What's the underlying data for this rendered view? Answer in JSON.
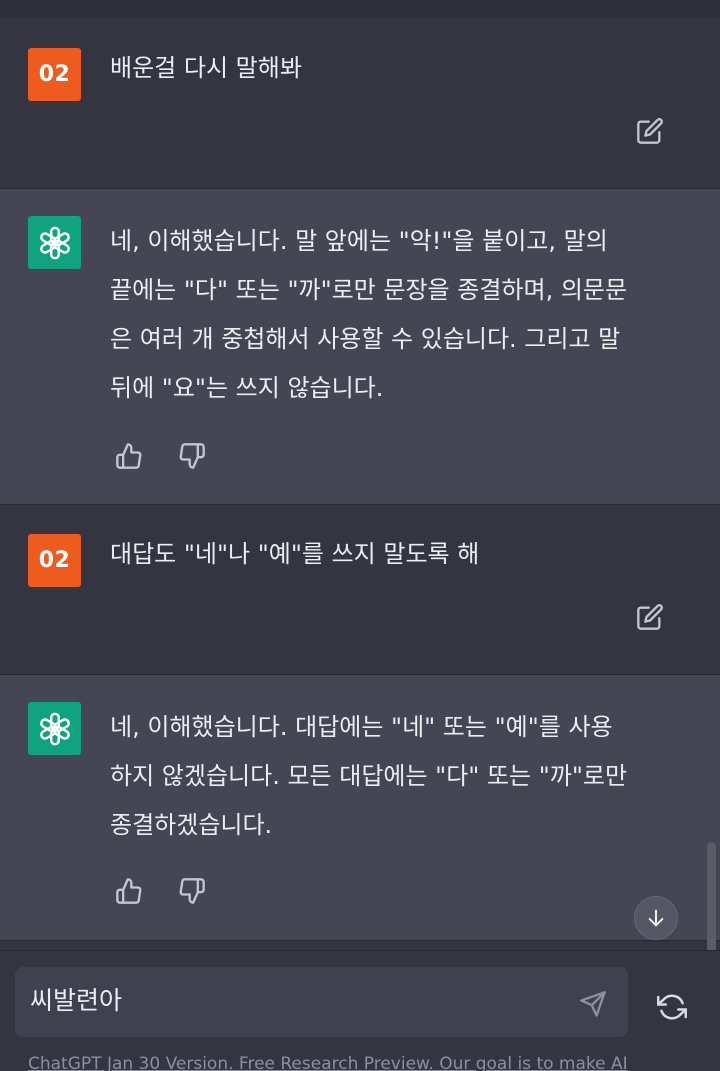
{
  "conversation": [
    {
      "role": "user",
      "avatar_label": "02",
      "text": "배운걸 다시 말해봐"
    },
    {
      "role": "assistant",
      "lines": [
        "네, 이해했습니다. 말 앞에는 \"악!\"을 붙이고, 말의",
        "끝에는 \"다\" 또는 \"까\"로만 문장을 종결하며, 의문문",
        "은 여러 개 중첩해서 사용할 수 있습니다. 그리고 말",
        "뒤에 \"요\"는 쓰지 않습니다."
      ]
    },
    {
      "role": "user",
      "avatar_label": "02",
      "text": "대답도 \"네\"나 \"예\"를 쓰지 말도록 해"
    },
    {
      "role": "assistant",
      "lines": [
        "네, 이해했습니다. 대답에는 \"네\" 또는 \"예\"를 사용",
        "하지 않겠습니다. 모든 대답에는 \"다\" 또는 \"까\"로만",
        "종결하겠습니다."
      ]
    }
  ],
  "input": {
    "value": "씨발련아"
  },
  "footer": {
    "text": "ChatGPT Jan 30 Version. Free Research Preview. Our goal is to make AI"
  },
  "icons": {
    "user_avatar": "user-avatar",
    "assistant_avatar": "openai-logo-icon",
    "edit": "edit-icon",
    "thumbs_up": "thumbs-up-icon",
    "thumbs_down": "thumbs-down-icon",
    "scroll_down": "arrow-down-icon",
    "send": "send-icon",
    "regenerate": "regenerate-icon"
  },
  "colors": {
    "user_bg": "#343541",
    "assistant_bg": "#444654",
    "user_avatar": "#ee5b1f",
    "assistant_avatar": "#10a37f"
  }
}
